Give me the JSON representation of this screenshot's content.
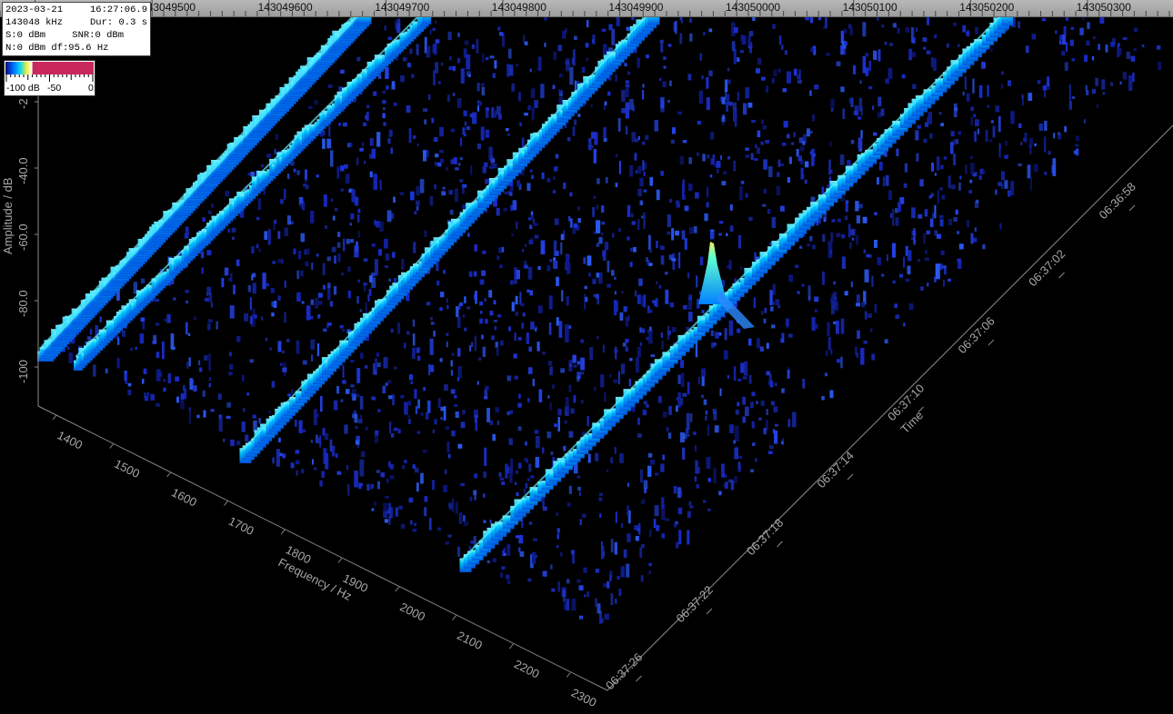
{
  "info": {
    "date": "2023-03-21",
    "time": "16:27:06.9",
    "center_freq": "143048 kHz",
    "duration": "Dur: 0.3 s",
    "signal": "S:0 dBm",
    "snr": "SNR:0 dBm",
    "noise_df": "N:0 dBm df:95.6 Hz"
  },
  "colorbar": {
    "labels": [
      "-100 dB",
      "-50",
      "0"
    ]
  },
  "top_ruler": {
    "labels": [
      "143049500",
      "143049600",
      "143049700",
      "143049800",
      "143049900",
      "143050000",
      "143050100",
      "143050200",
      "143050300"
    ]
  },
  "amplitude_axis": {
    "title": "Amplitude / dB",
    "ticks": [
      "-2",
      "-40.0",
      "-60.0",
      "-80.0",
      "-100"
    ]
  },
  "frequency_axis": {
    "title": "Frequency / Hz",
    "ticks": [
      "1400",
      "1500",
      "1600",
      "1700",
      "1800",
      "1900",
      "2000",
      "2100",
      "2200",
      "2300"
    ]
  },
  "time_axis": {
    "title": "Time",
    "ticks": [
      "06:36:58",
      "06:37:02",
      "06:37:06",
      "06:37:10",
      "06:37:14",
      "06:37:18",
      "06:37:22",
      "06:37:26"
    ]
  },
  "colors": {
    "background": "#000000",
    "axis": "#a8a8a8",
    "trace_hot": "#00e8ff",
    "trace_mid": "#0090ff",
    "noise": "#1a2cc8"
  }
}
